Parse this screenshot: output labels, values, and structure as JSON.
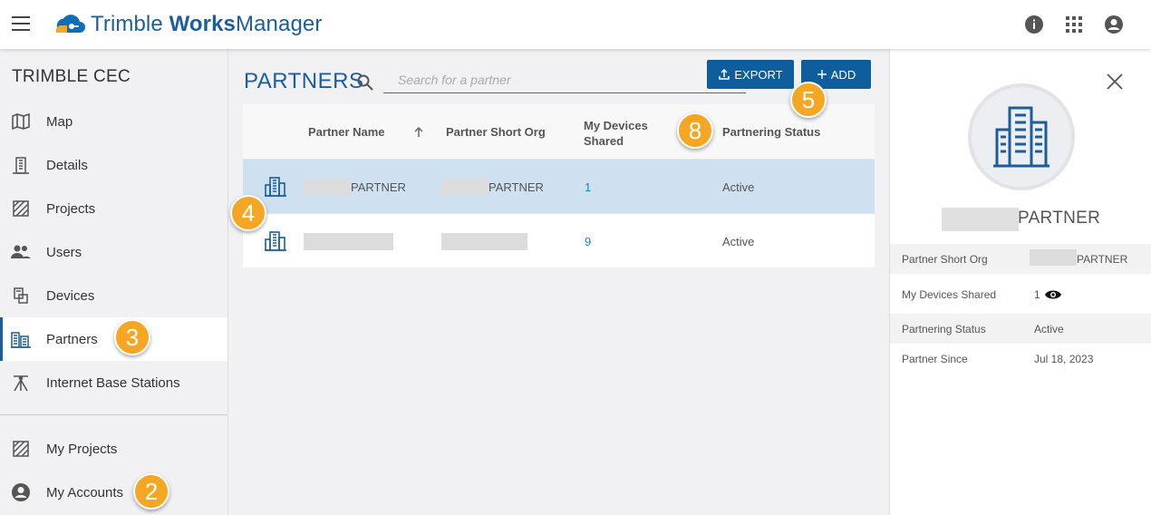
{
  "header": {
    "brand_prefix": "Trimble ",
    "brand_bold": "Works",
    "brand_suffix": "Manager",
    "icons": [
      "menu-icon",
      "info-icon",
      "apps-grid-icon",
      "account-icon"
    ]
  },
  "sidebar": {
    "org_name": "TRIMBLE CEC",
    "items": [
      {
        "label": "Map",
        "icon": "map-icon"
      },
      {
        "label": "Details",
        "icon": "building-icon"
      },
      {
        "label": "Projects",
        "icon": "projects-icon"
      },
      {
        "label": "Users",
        "icon": "users-icon"
      },
      {
        "label": "Devices",
        "icon": "devices-icon"
      },
      {
        "label": "Partners",
        "icon": "partners-icon",
        "active": true
      },
      {
        "label": "Internet Base Stations",
        "icon": "tripod-icon"
      }
    ],
    "bottom_items": [
      {
        "label": "My Projects",
        "icon": "projects-icon"
      },
      {
        "label": "My Accounts",
        "icon": "account-circle-icon"
      }
    ]
  },
  "main": {
    "title": "PARTNERS",
    "search_placeholder": "Search for a partner",
    "export_label": "EXPORT",
    "add_label": "ADD",
    "columns": {
      "partner_name": "Partner Name",
      "short_org": "Partner Short Org",
      "devices_shared": "My Devices Shared",
      "status": "Partnering Status"
    },
    "rows": [
      {
        "name": "PARTNER",
        "short_org": "PARTNER",
        "devices_shared": "1",
        "status": "Active",
        "selected": true
      },
      {
        "name": "",
        "short_org": "",
        "devices_shared": "9",
        "status": "Active",
        "selected": false
      }
    ]
  },
  "panel": {
    "name": "PARTNER",
    "fields": [
      {
        "label": "Partner Short Org",
        "value": "PARTNER"
      },
      {
        "label": "My Devices Shared",
        "value": "1"
      },
      {
        "label": "Partnering Status",
        "value": "Active"
      },
      {
        "label": "Partner Since",
        "value": "Jul 18, 2023"
      }
    ]
  },
  "callouts": [
    "2",
    "3",
    "4",
    "5",
    "8"
  ],
  "colors": {
    "brand_blue": "#1b5e9b",
    "button_blue": "#0e5e9e",
    "selected_row": "#cfe1f1",
    "callout_orange": "#f5a623"
  }
}
